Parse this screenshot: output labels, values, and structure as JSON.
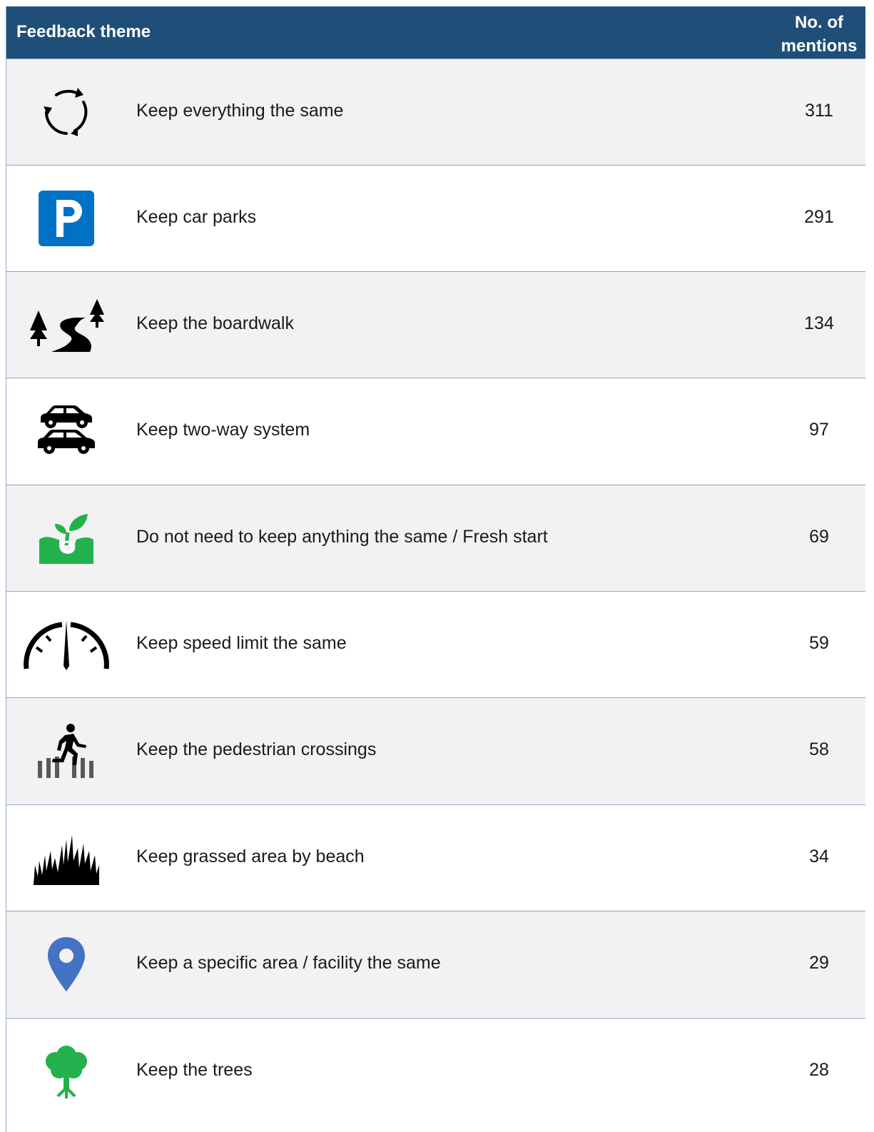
{
  "header": {
    "theme": "Feedback theme",
    "count_line1": "No. of",
    "count_line2": "mentions"
  },
  "rows": [
    {
      "label": "Keep everything the same",
      "count": "311",
      "icon": "refresh-cycle-icon"
    },
    {
      "label": "Keep car parks",
      "count": "291",
      "icon": "parking-sign-icon"
    },
    {
      "label": "Keep the boardwalk",
      "count": "134",
      "icon": "path-with-trees-icon"
    },
    {
      "label": "Keep two-way system",
      "count": "97",
      "icon": "two-cars-icon"
    },
    {
      "label": "Do not need to keep anything the same / Fresh start",
      "count": "69",
      "icon": "sprout-icon"
    },
    {
      "label": "Keep speed limit the same",
      "count": "59",
      "icon": "speedometer-icon"
    },
    {
      "label": "Keep the pedestrian crossings",
      "count": "58",
      "icon": "pedestrian-crossing-icon"
    },
    {
      "label": "Keep grassed area by beach",
      "count": "34",
      "icon": "grass-icon"
    },
    {
      "label": "Keep a specific area / facility the same",
      "count": "29",
      "icon": "location-pin-icon"
    },
    {
      "label": "Keep the trees",
      "count": "28",
      "icon": "tree-icon"
    }
  ],
  "colors": {
    "header_bg": "#1f4e79",
    "row_shade": "#f2f2f2",
    "border": "#8ea6c9",
    "parking_blue": "#0072c6",
    "pin_blue": "#4472c4",
    "green": "#22b14c"
  }
}
